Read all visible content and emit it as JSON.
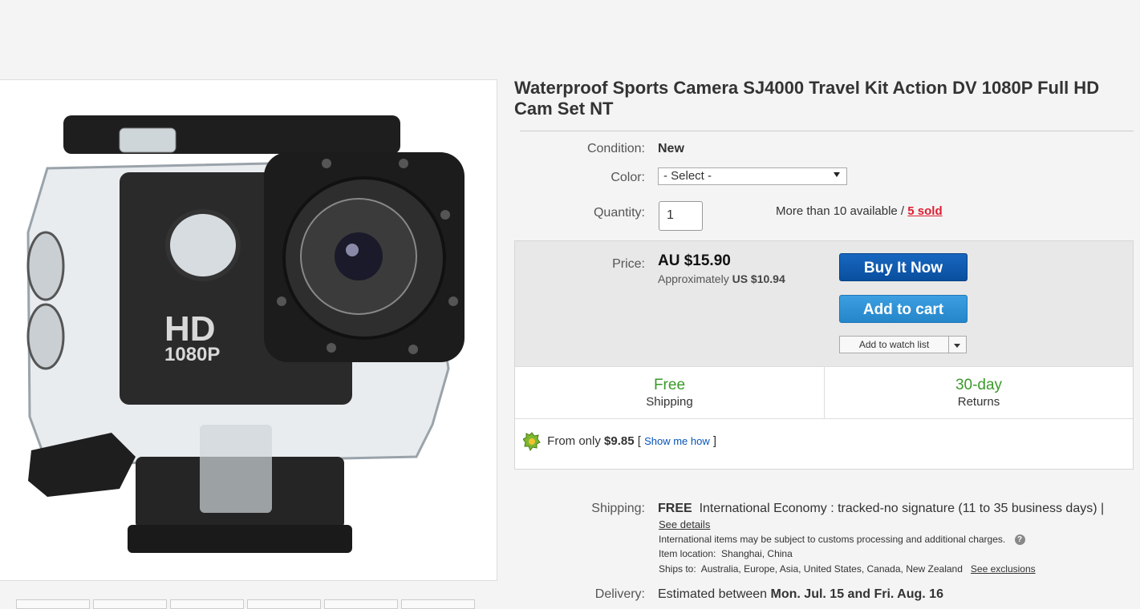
{
  "product": {
    "title": "Waterproof Sports Camera SJ4000 Travel Kit Action DV 1080P Full HD Cam Set NT",
    "image_text_hd": "HD",
    "image_text_res": "1080P"
  },
  "condition": {
    "label": "Condition:",
    "value": "New"
  },
  "color": {
    "label": "Color:",
    "selected": "- Select -"
  },
  "quantity": {
    "label": "Quantity:",
    "value": "1",
    "availability": "More than 10 available /",
    "sold": "5 sold"
  },
  "price": {
    "label": "Price:",
    "amount": "AU $15.90",
    "approx_label": "Approximately",
    "approx_value": "US $10.94"
  },
  "buttons": {
    "buy_now": "Buy It Now",
    "add_to_cart": "Add to cart",
    "watch_list": "Add to watch list"
  },
  "highlights": {
    "shipping_big": "Free",
    "shipping_small": "Shipping",
    "returns_big": "30-day",
    "returns_small": "Returns"
  },
  "financing": {
    "prefix": "From only",
    "amount": "$9.85",
    "bracket_open": "[",
    "link": "Show me how",
    "bracket_close": "]"
  },
  "shipping": {
    "label": "Shipping:",
    "free": "FREE",
    "method": "International Economy : tracked-no signature (11 to 35 business days) |",
    "see_details": "See details",
    "customs_note": "International items may be subject to customs processing and additional charges.",
    "location_label": "Item location:",
    "location": "Shanghai, China",
    "ships_to_label": "Ships to:",
    "ships_to": "Australia, Europe, Asia, United States, Canada, New Zealand",
    "see_exclusions": "See exclusions"
  },
  "delivery": {
    "label": "Delivery:",
    "prefix": "Estimated between",
    "range": "Mon. Jul. 15 and Fri. Aug. 16"
  },
  "colors": {
    "buy_now": "#0a4f9e",
    "add_to_cart": "#2586c9",
    "highlight_green": "#3a9a2a",
    "sold_red": "#dd1e31",
    "link_blue": "#0654ba"
  }
}
